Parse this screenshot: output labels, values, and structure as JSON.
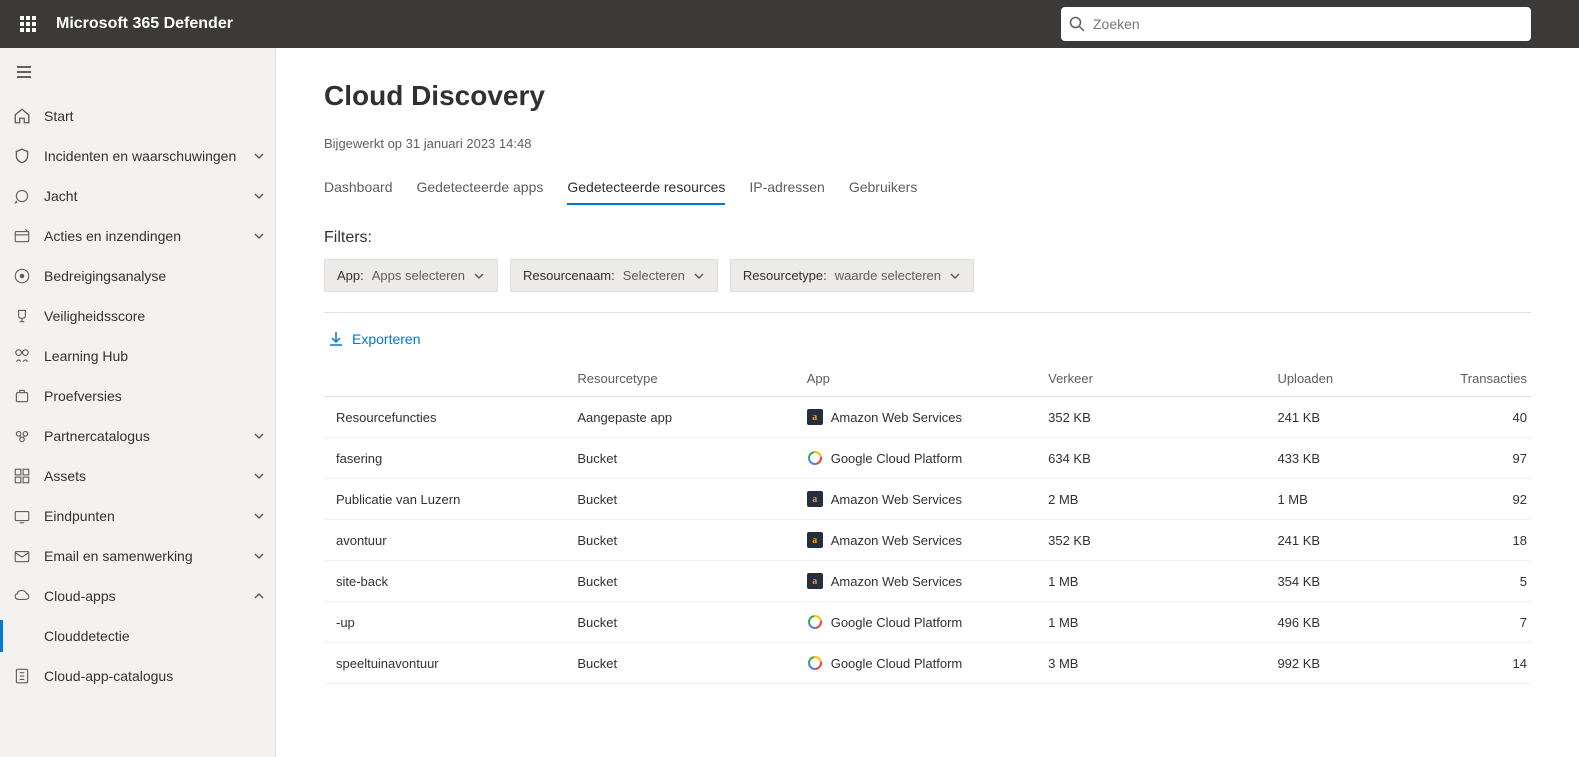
{
  "header": {
    "app_title": "Microsoft 365 Defender",
    "search_placeholder": "Zoeken"
  },
  "sidebar": {
    "items": [
      {
        "label": "Start",
        "icon": "home",
        "expandable": false
      },
      {
        "label": "Incidenten en waarschuwingen",
        "icon": "shield",
        "expandable": true
      },
      {
        "label": "Jacht",
        "icon": "target",
        "expandable": true
      },
      {
        "label": "Acties en inzendingen",
        "icon": "action",
        "expandable": true
      },
      {
        "label": "Bedreigingsanalyse",
        "icon": "threat",
        "expandable": false
      },
      {
        "label": "Veiligheidsscore",
        "icon": "trophy",
        "expandable": false
      },
      {
        "label": "Learning Hub",
        "icon": "learn",
        "expandable": false
      },
      {
        "label": "Proefversies",
        "icon": "trial",
        "expandable": false
      },
      {
        "label": "Partnercatalogus",
        "icon": "partner",
        "expandable": true
      },
      {
        "label": "Assets",
        "icon": "assets",
        "expandable": true
      },
      {
        "label": "Eindpunten",
        "icon": "endpoint",
        "expandable": true
      },
      {
        "label": "Email en samenwerking",
        "icon": "email",
        "expandable": true
      },
      {
        "label": "Cloud-apps",
        "icon": "cloud",
        "expandable": true,
        "expanded": true
      },
      {
        "label": "Clouddetectie",
        "icon": "",
        "indent": true,
        "active": true
      },
      {
        "label": "Cloud-app-catalogus",
        "icon": "catalog",
        "expandable": false
      }
    ]
  },
  "main": {
    "title": "Cloud Discovery",
    "updated": "Bijgewerkt op 31 januari 2023 14:48",
    "tabs": [
      {
        "label": "Dashboard"
      },
      {
        "label": "Gedetecteerde apps"
      },
      {
        "label": "Gedetecteerde resources",
        "active": true
      },
      {
        "label": "IP-adressen"
      },
      {
        "label": "Gebruikers"
      }
    ],
    "filters_label": "Filters:",
    "filters": [
      {
        "prefix": "App:",
        "value": "Apps selecteren"
      },
      {
        "prefix": "Resourcenaam:",
        "value": "Selecteren"
      },
      {
        "prefix": "Resourcetype:",
        "value": "waarde selecteren"
      }
    ],
    "export_label": "Exporteren",
    "table": {
      "columns": [
        "",
        "Resourcetype",
        "App",
        "Verkeer",
        "Uploaden",
        "Transacties"
      ],
      "rows": [
        {
          "name": "Resourcefuncties",
          "type": "Aangepaste app",
          "app": "Amazon Web Services",
          "app_icon": "aws",
          "traffic": "352 KB",
          "upload": "241 KB",
          "tx": "40"
        },
        {
          "name": "fasering",
          "type": "Bucket",
          "app": "Google Cloud Platform",
          "app_icon": "gcp",
          "traffic": "634 KB",
          "upload": "433 KB",
          "tx": "97"
        },
        {
          "name": "Publicatie van Luzern",
          "type": "Bucket",
          "app": "Amazon Web Services",
          "app_icon": "aws",
          "traffic": "2 MB",
          "upload": "1 MB",
          "tx": "92"
        },
        {
          "name": "avontuur",
          "type": "Bucket",
          "app": "Amazon Web Services",
          "app_icon": "aws",
          "traffic": "352 KB",
          "upload": "241 KB",
          "tx": "18"
        },
        {
          "name": "site-back",
          "type": "Bucket",
          "app": "Amazon Web Services",
          "app_icon": "aws",
          "traffic": "1 MB",
          "upload": "354 KB",
          "tx": "5"
        },
        {
          "name": "-up",
          "type": "Bucket",
          "app": "Google Cloud Platform",
          "app_icon": "gcp",
          "traffic": "1 MB",
          "upload": "496 KB",
          "tx": "7"
        },
        {
          "name": "speeltuinavontuur",
          "type": "Bucket",
          "app": "Google Cloud Platform",
          "app_icon": "gcp",
          "traffic": "3 MB",
          "upload": "992 KB",
          "tx": "14"
        }
      ]
    }
  }
}
